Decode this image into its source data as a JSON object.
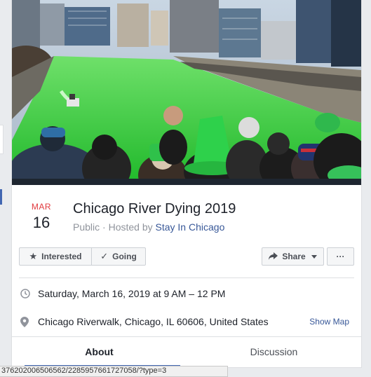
{
  "event": {
    "month": "MAR",
    "day": "16",
    "title": "Chicago River Dying 2019",
    "visibility": "Public",
    "hosted_by_prefix": " · Hosted by ",
    "host": "Stay In Chicago"
  },
  "actions": {
    "interested": "Interested",
    "going": "Going",
    "share": "Share",
    "more": "···"
  },
  "details": {
    "datetime": "Saturday, March 16, 2019 at 9 AM – 12 PM",
    "location": "Chicago Riverwalk, Chicago, IL 60606, United States",
    "show_map": "Show Map"
  },
  "tabs": [
    "About",
    "Discussion"
  ],
  "status_bar": {
    "url": "37620200650656​2/2285957661727058/?type=3"
  },
  "colors": {
    "river_green": "#3fd13a",
    "accent_blue": "#4267b2",
    "month_red": "#e0393e",
    "link_blue": "#385898"
  }
}
